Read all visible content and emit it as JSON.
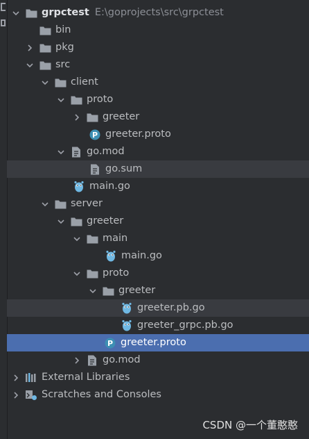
{
  "tree": {
    "root": {
      "name": "grpctest",
      "path": "E:\\goprojects\\src\\grpctest"
    },
    "items": [
      {
        "label": "bin"
      },
      {
        "label": "pkg"
      },
      {
        "label": "src"
      },
      {
        "label": "client"
      },
      {
        "label": "proto"
      },
      {
        "label": "greeter"
      },
      {
        "label": "greeter.proto"
      },
      {
        "label": "go.mod"
      },
      {
        "label": "go.sum"
      },
      {
        "label": "main.go"
      },
      {
        "label": "server"
      },
      {
        "label": "greeter"
      },
      {
        "label": "main"
      },
      {
        "label": "main.go"
      },
      {
        "label": "proto"
      },
      {
        "label": "greeter"
      },
      {
        "label": "greeter.pb.go"
      },
      {
        "label": "greeter_grpc.pb.go"
      },
      {
        "label": "greeter.proto"
      },
      {
        "label": "go.mod"
      }
    ],
    "external_libraries": "External Libraries",
    "scratches": "Scratches and Consoles"
  },
  "watermark": "CSDN @一个董憨憨",
  "colors": {
    "background": "#2b2d30",
    "selected": "#4b6eaf",
    "highlight": "#393b40",
    "folder": "#9aa0a8",
    "gopher": "#6fb8e3",
    "proto": "#3d8fb3"
  }
}
